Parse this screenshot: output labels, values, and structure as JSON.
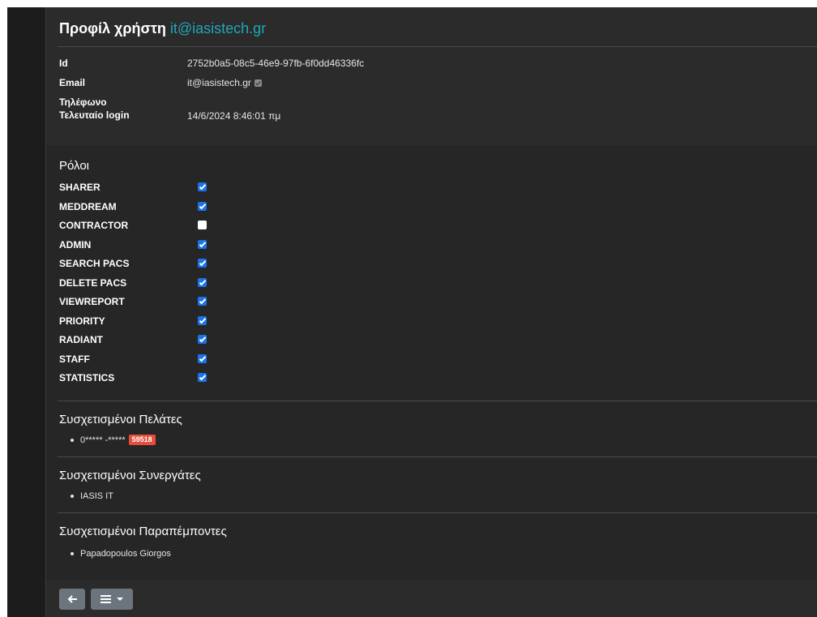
{
  "header": {
    "title_prefix": "Προφίλ χρήστη",
    "title_email": "it@iasistech.gr"
  },
  "fields": {
    "id_label": "Id",
    "id_value": "2752b0a5-08c5-46e9-97fb-6f0dd46336fc",
    "email_label": "Email",
    "email_value": "it@iasistech.gr",
    "email_confirmed": true,
    "phone_label": "Τηλέφωνο",
    "phone_value": "",
    "last_login_label": "Τελευταίο login",
    "last_login_value": "14/6/2024 8:46:01 πμ"
  },
  "roles": {
    "title": "Ρόλοι",
    "items": [
      {
        "label": "SHARER",
        "checked": true
      },
      {
        "label": "MEDDREAM",
        "checked": true
      },
      {
        "label": "CONTRACTOR",
        "checked": false
      },
      {
        "label": "ADMIN",
        "checked": true
      },
      {
        "label": "SEARCH PACS",
        "checked": true
      },
      {
        "label": "DELETE PACS",
        "checked": true
      },
      {
        "label": "VIEWREPORT",
        "checked": true
      },
      {
        "label": "PRIORITY",
        "checked": true
      },
      {
        "label": "RADIANT",
        "checked": true
      },
      {
        "label": "STAFF",
        "checked": true
      },
      {
        "label": "STATISTICS",
        "checked": true
      }
    ]
  },
  "customers": {
    "title": "Συσχετισμένοι Πελάτες",
    "items": [
      {
        "name": "0***** -*****",
        "badge": "59518"
      }
    ]
  },
  "partners": {
    "title": "Συσχετισμένοι Συνεργάτες",
    "items": [
      {
        "name": "IASIS IT"
      }
    ]
  },
  "referrers": {
    "title": "Συσχετισμένοι Παραπέμποντες",
    "items": [
      {
        "name": "Papadopoulos Giorgos"
      }
    ]
  },
  "footer": {
    "back_icon": "arrow-left-icon",
    "menu_icon": "hamburger-menu-icon"
  },
  "colors": {
    "accent": "#1fa7b8",
    "checkbox": "#1a73e8",
    "badge": "#e74c3c",
    "button": "#6c757d"
  }
}
